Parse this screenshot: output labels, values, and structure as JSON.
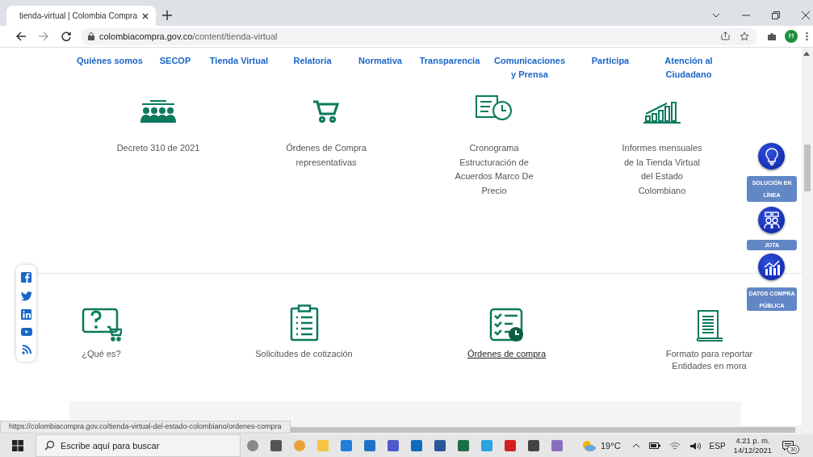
{
  "browser": {
    "tab_title": "tienda-virtual | Colombia Compra",
    "url_host": "colombiacompra.gov.co",
    "url_path": "/content/tienda-virtual",
    "profile_initial": "H"
  },
  "nav": [
    {
      "label": "Quiénes somos"
    },
    {
      "label": "SECOP"
    },
    {
      "label": "Tienda Virtual"
    },
    {
      "label": "Relatoría"
    },
    {
      "label": "Normativa"
    },
    {
      "label": "Transparencia"
    },
    {
      "label": "Comunicaciones y Prensa"
    },
    {
      "label": "Participa"
    },
    {
      "label": "Atención al Ciudadano"
    }
  ],
  "features_top": [
    {
      "label": "Decreto 310 de 2021"
    },
    {
      "label": "Órdenes de Compra representativas"
    },
    {
      "label": "Cronograma Estructuración de Acuerdos Marco De Precio"
    },
    {
      "label": "Informes mensuales de la Tienda Virtual del Estado Colombiano"
    }
  ],
  "features_bottom": [
    {
      "label": "¿Qué es?",
      "hovered": false
    },
    {
      "label": "Solicitudes de cotización",
      "hovered": false
    },
    {
      "label": "Órdenes de compra",
      "hovered": true
    },
    {
      "label": "Formato para reportar Entidades en mora",
      "hovered": false
    }
  ],
  "side_buttons": [
    {
      "label": "SOLUCIÓN EN LÍNEA"
    },
    {
      "label": "JOTA"
    },
    {
      "label": "DATOS COMPRA PÚBLICA"
    }
  ],
  "status_url": "https://colombiacompra.gov.co/tienda-virtual-del-estado-colombiano/ordenes-compra",
  "taskbar": {
    "search_placeholder": "Escribe aquí para buscar",
    "temperature": "19°C",
    "language": "ESP",
    "time": "4:21 p. m.",
    "date": "14/12/2021",
    "notifications": "30"
  }
}
